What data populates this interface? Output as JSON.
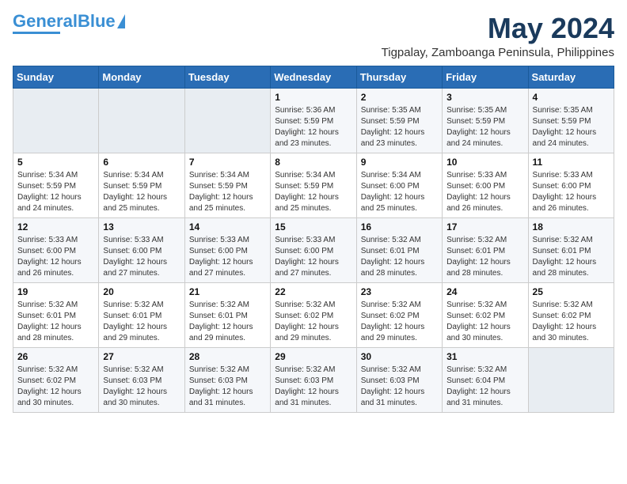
{
  "logo": {
    "text_general": "General",
    "text_blue": "Blue"
  },
  "title": {
    "month_year": "May 2024",
    "location": "Tigpalay, Zamboanga Peninsula, Philippines"
  },
  "days_of_week": [
    "Sunday",
    "Monday",
    "Tuesday",
    "Wednesday",
    "Thursday",
    "Friday",
    "Saturday"
  ],
  "weeks": [
    [
      {
        "day": "",
        "sunrise": "",
        "sunset": "",
        "daylight": "",
        "empty": true
      },
      {
        "day": "",
        "sunrise": "",
        "sunset": "",
        "daylight": "",
        "empty": true
      },
      {
        "day": "",
        "sunrise": "",
        "sunset": "",
        "daylight": "",
        "empty": true
      },
      {
        "day": "1",
        "sunrise": "Sunrise: 5:36 AM",
        "sunset": "Sunset: 5:59 PM",
        "daylight": "Daylight: 12 hours and 23 minutes."
      },
      {
        "day": "2",
        "sunrise": "Sunrise: 5:35 AM",
        "sunset": "Sunset: 5:59 PM",
        "daylight": "Daylight: 12 hours and 23 minutes."
      },
      {
        "day": "3",
        "sunrise": "Sunrise: 5:35 AM",
        "sunset": "Sunset: 5:59 PM",
        "daylight": "Daylight: 12 hours and 24 minutes."
      },
      {
        "day": "4",
        "sunrise": "Sunrise: 5:35 AM",
        "sunset": "Sunset: 5:59 PM",
        "daylight": "Daylight: 12 hours and 24 minutes."
      }
    ],
    [
      {
        "day": "5",
        "sunrise": "Sunrise: 5:34 AM",
        "sunset": "Sunset: 5:59 PM",
        "daylight": "Daylight: 12 hours and 24 minutes."
      },
      {
        "day": "6",
        "sunrise": "Sunrise: 5:34 AM",
        "sunset": "Sunset: 5:59 PM",
        "daylight": "Daylight: 12 hours and 25 minutes."
      },
      {
        "day": "7",
        "sunrise": "Sunrise: 5:34 AM",
        "sunset": "Sunset: 5:59 PM",
        "daylight": "Daylight: 12 hours and 25 minutes."
      },
      {
        "day": "8",
        "sunrise": "Sunrise: 5:34 AM",
        "sunset": "Sunset: 5:59 PM",
        "daylight": "Daylight: 12 hours and 25 minutes."
      },
      {
        "day": "9",
        "sunrise": "Sunrise: 5:34 AM",
        "sunset": "Sunset: 6:00 PM",
        "daylight": "Daylight: 12 hours and 25 minutes."
      },
      {
        "day": "10",
        "sunrise": "Sunrise: 5:33 AM",
        "sunset": "Sunset: 6:00 PM",
        "daylight": "Daylight: 12 hours and 26 minutes."
      },
      {
        "day": "11",
        "sunrise": "Sunrise: 5:33 AM",
        "sunset": "Sunset: 6:00 PM",
        "daylight": "Daylight: 12 hours and 26 minutes."
      }
    ],
    [
      {
        "day": "12",
        "sunrise": "Sunrise: 5:33 AM",
        "sunset": "Sunset: 6:00 PM",
        "daylight": "Daylight: 12 hours and 26 minutes."
      },
      {
        "day": "13",
        "sunrise": "Sunrise: 5:33 AM",
        "sunset": "Sunset: 6:00 PM",
        "daylight": "Daylight: 12 hours and 27 minutes."
      },
      {
        "day": "14",
        "sunrise": "Sunrise: 5:33 AM",
        "sunset": "Sunset: 6:00 PM",
        "daylight": "Daylight: 12 hours and 27 minutes."
      },
      {
        "day": "15",
        "sunrise": "Sunrise: 5:33 AM",
        "sunset": "Sunset: 6:00 PM",
        "daylight": "Daylight: 12 hours and 27 minutes."
      },
      {
        "day": "16",
        "sunrise": "Sunrise: 5:32 AM",
        "sunset": "Sunset: 6:01 PM",
        "daylight": "Daylight: 12 hours and 28 minutes."
      },
      {
        "day": "17",
        "sunrise": "Sunrise: 5:32 AM",
        "sunset": "Sunset: 6:01 PM",
        "daylight": "Daylight: 12 hours and 28 minutes."
      },
      {
        "day": "18",
        "sunrise": "Sunrise: 5:32 AM",
        "sunset": "Sunset: 6:01 PM",
        "daylight": "Daylight: 12 hours and 28 minutes."
      }
    ],
    [
      {
        "day": "19",
        "sunrise": "Sunrise: 5:32 AM",
        "sunset": "Sunset: 6:01 PM",
        "daylight": "Daylight: 12 hours and 28 minutes."
      },
      {
        "day": "20",
        "sunrise": "Sunrise: 5:32 AM",
        "sunset": "Sunset: 6:01 PM",
        "daylight": "Daylight: 12 hours and 29 minutes."
      },
      {
        "day": "21",
        "sunrise": "Sunrise: 5:32 AM",
        "sunset": "Sunset: 6:01 PM",
        "daylight": "Daylight: 12 hours and 29 minutes."
      },
      {
        "day": "22",
        "sunrise": "Sunrise: 5:32 AM",
        "sunset": "Sunset: 6:02 PM",
        "daylight": "Daylight: 12 hours and 29 minutes."
      },
      {
        "day": "23",
        "sunrise": "Sunrise: 5:32 AM",
        "sunset": "Sunset: 6:02 PM",
        "daylight": "Daylight: 12 hours and 29 minutes."
      },
      {
        "day": "24",
        "sunrise": "Sunrise: 5:32 AM",
        "sunset": "Sunset: 6:02 PM",
        "daylight": "Daylight: 12 hours and 30 minutes."
      },
      {
        "day": "25",
        "sunrise": "Sunrise: 5:32 AM",
        "sunset": "Sunset: 6:02 PM",
        "daylight": "Daylight: 12 hours and 30 minutes."
      }
    ],
    [
      {
        "day": "26",
        "sunrise": "Sunrise: 5:32 AM",
        "sunset": "Sunset: 6:02 PM",
        "daylight": "Daylight: 12 hours and 30 minutes."
      },
      {
        "day": "27",
        "sunrise": "Sunrise: 5:32 AM",
        "sunset": "Sunset: 6:03 PM",
        "daylight": "Daylight: 12 hours and 30 minutes."
      },
      {
        "day": "28",
        "sunrise": "Sunrise: 5:32 AM",
        "sunset": "Sunset: 6:03 PM",
        "daylight": "Daylight: 12 hours and 31 minutes."
      },
      {
        "day": "29",
        "sunrise": "Sunrise: 5:32 AM",
        "sunset": "Sunset: 6:03 PM",
        "daylight": "Daylight: 12 hours and 31 minutes."
      },
      {
        "day": "30",
        "sunrise": "Sunrise: 5:32 AM",
        "sunset": "Sunset: 6:03 PM",
        "daylight": "Daylight: 12 hours and 31 minutes."
      },
      {
        "day": "31",
        "sunrise": "Sunrise: 5:32 AM",
        "sunset": "Sunset: 6:04 PM",
        "daylight": "Daylight: 12 hours and 31 minutes."
      },
      {
        "day": "",
        "sunrise": "",
        "sunset": "",
        "daylight": "",
        "empty": true
      }
    ]
  ]
}
